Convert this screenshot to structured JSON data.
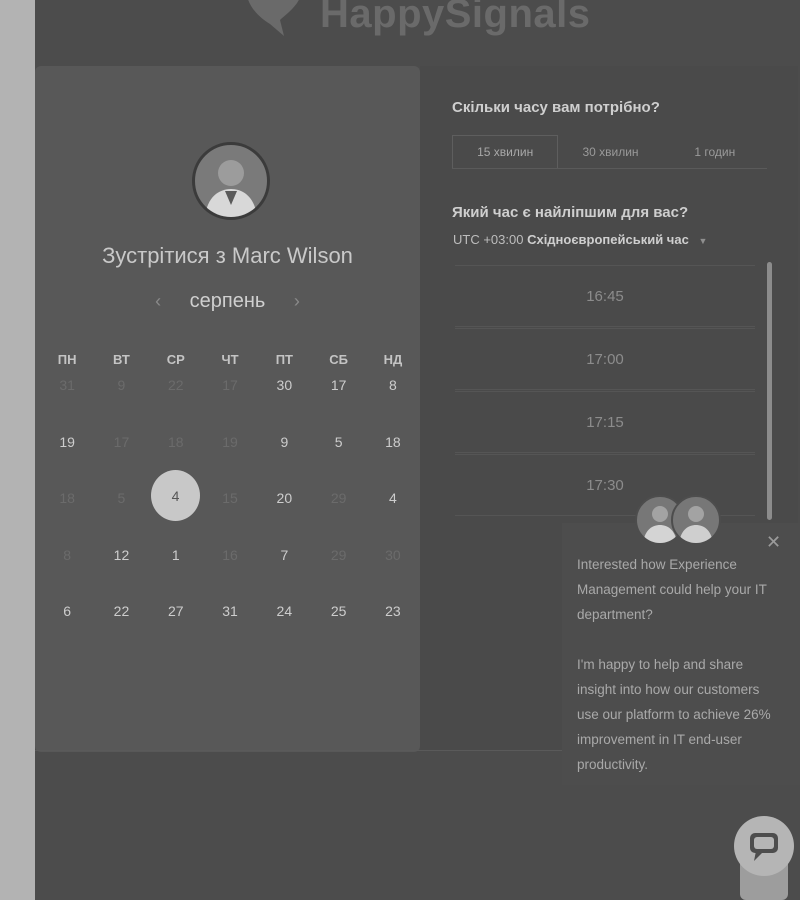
{
  "brand": {
    "name": "HappySignals"
  },
  "booking": {
    "title": "Зустрітися з Marc Wilson",
    "month": "серпень",
    "weekdays": [
      "ПН",
      "ВТ",
      "СР",
      "ЧТ",
      "ПТ",
      "СБ",
      "НД"
    ],
    "weeks": [
      [
        "31",
        "9",
        "22",
        "17",
        "30",
        "17",
        "8"
      ],
      [
        "19",
        "17",
        "18",
        "19",
        "9",
        "5",
        "18"
      ],
      [
        "18",
        "5",
        "4",
        "15",
        "20",
        "29",
        "4"
      ],
      [
        "8",
        "12",
        "1",
        "16",
        "7",
        "29",
        "30"
      ],
      [
        "6",
        "22",
        "27",
        "31",
        "24",
        "25",
        "23"
      ]
    ],
    "dimmed": [
      [
        true,
        true,
        true,
        true,
        false,
        false,
        false
      ],
      [
        false,
        true,
        true,
        true,
        false,
        false,
        false
      ],
      [
        true,
        true,
        false,
        true,
        false,
        true,
        false
      ],
      [
        true,
        false,
        false,
        true,
        false,
        true,
        true
      ],
      [
        false,
        false,
        false,
        false,
        false,
        false,
        false
      ]
    ],
    "selected_day": "4"
  },
  "duration": {
    "question": "Скільки часу вам потрібно?",
    "options": [
      "15 хвилин",
      "30 хвилин",
      "1 годин"
    ],
    "selected": "15 хвилин"
  },
  "time": {
    "question": "Який час є найліпшим для вас?",
    "tz_offset": "UTC +03:00",
    "tz_name": "Східноєвропейський час",
    "slots": [
      "16:45",
      "17:00",
      "17:15",
      "17:30"
    ]
  },
  "chat": {
    "message_1": "Interested how Experience Management could help your IT department?",
    "message_2": "I'm happy to help and share insight into how our customers use our platform to achieve 26% improvement in IT end-user productivity."
  },
  "icons": {
    "logo": "speech-bubble-heart-icon",
    "prev": "chevron-left-icon",
    "next": "chevron-right-icon",
    "tz_caret": "caret-down-icon",
    "close": "close-icon",
    "launcher": "chat-bubble-icon"
  }
}
